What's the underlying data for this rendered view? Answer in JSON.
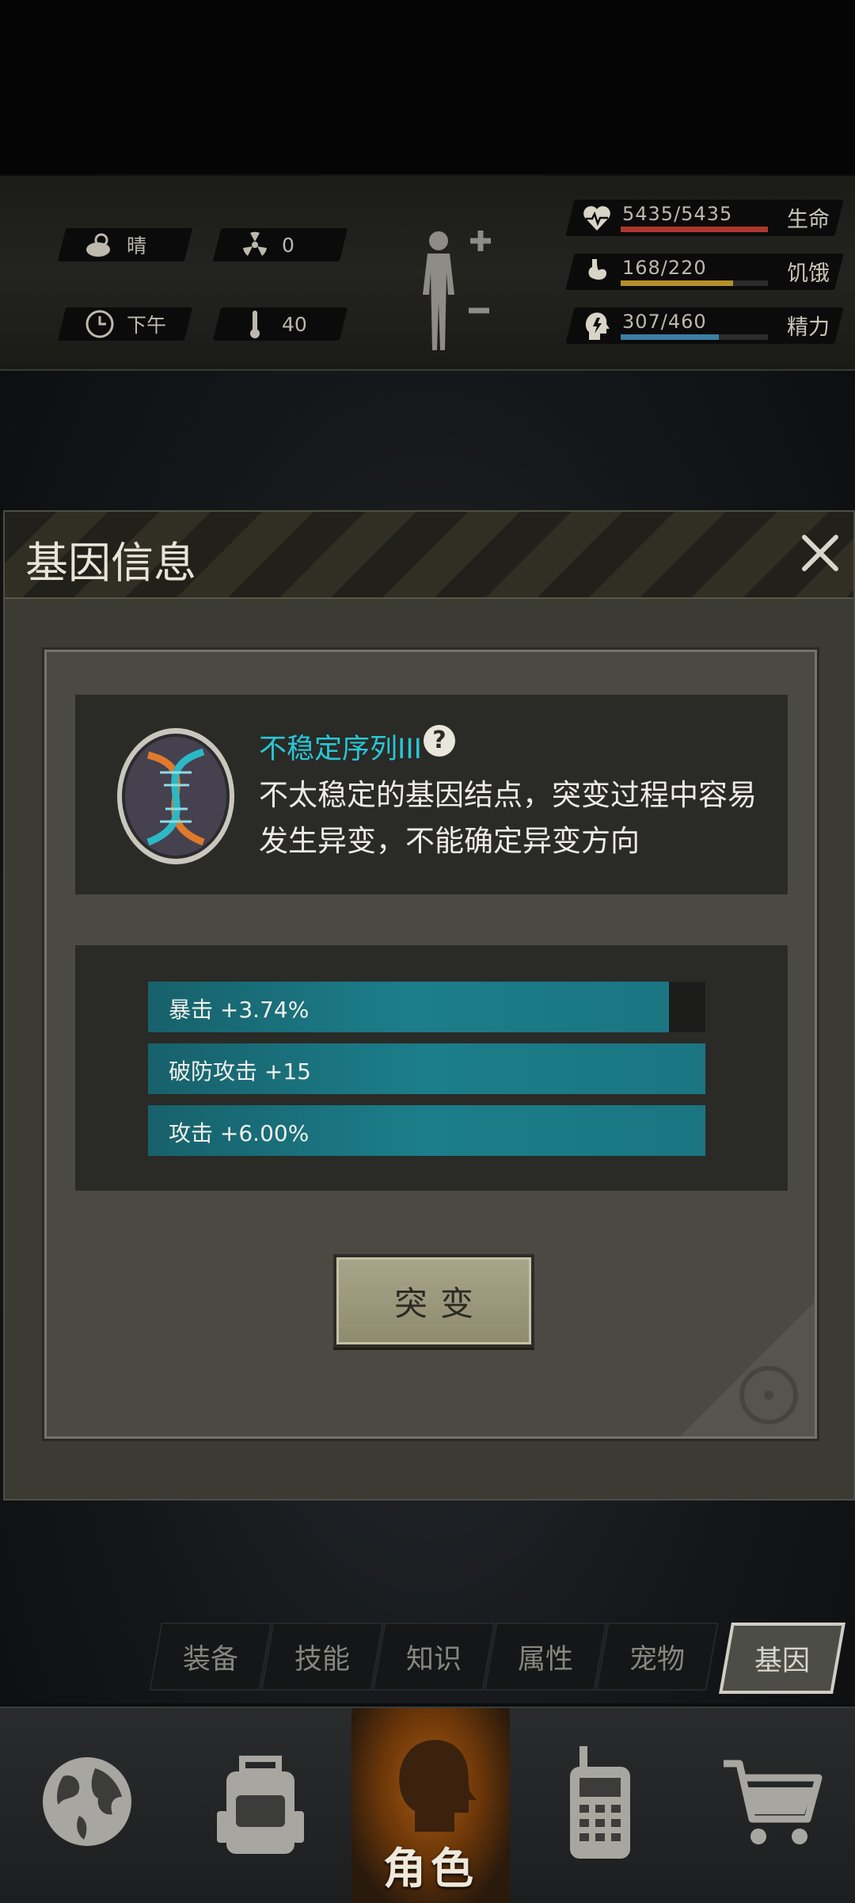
{
  "status": {
    "weather": "晴",
    "radiation": "0",
    "time_of_day": "下午",
    "temperature": "40",
    "vitals": [
      {
        "label": "生命",
        "value": "5435/5435",
        "fraction": 1.0,
        "color": "#b0372f",
        "icon": "heart-pulse-icon"
      },
      {
        "label": "饥饿",
        "value": "168/220",
        "fraction": 0.764,
        "color": "#b4902b",
        "icon": "stomach-icon"
      },
      {
        "label": "精力",
        "value": "307/460",
        "fraction": 0.667,
        "color": "#3b7fa3",
        "icon": "head-energy-icon"
      }
    ]
  },
  "dialog": {
    "title": "基因信息",
    "gene": {
      "name": "不稳定序列III",
      "help_symbol": "?",
      "description": "不太稳定的基因结点，突变过程中容易发生异变，不能确定异变方向"
    },
    "bonuses": [
      {
        "text": "暴击 +3.74%",
        "fraction": 0.935
      },
      {
        "text": "破防攻击 +15",
        "fraction": 1.0
      },
      {
        "text": "攻击 +6.00%",
        "fraction": 1.0
      }
    ],
    "mutate_label": "突变"
  },
  "tabs": [
    "装备",
    "技能",
    "知识",
    "属性",
    "宠物",
    "基因"
  ],
  "active_tab": "基因",
  "nav": {
    "items": [
      "globe-icon",
      "backpack-icon",
      "character-icon",
      "radio-icon",
      "cart-icon"
    ],
    "center_label": "角色"
  }
}
